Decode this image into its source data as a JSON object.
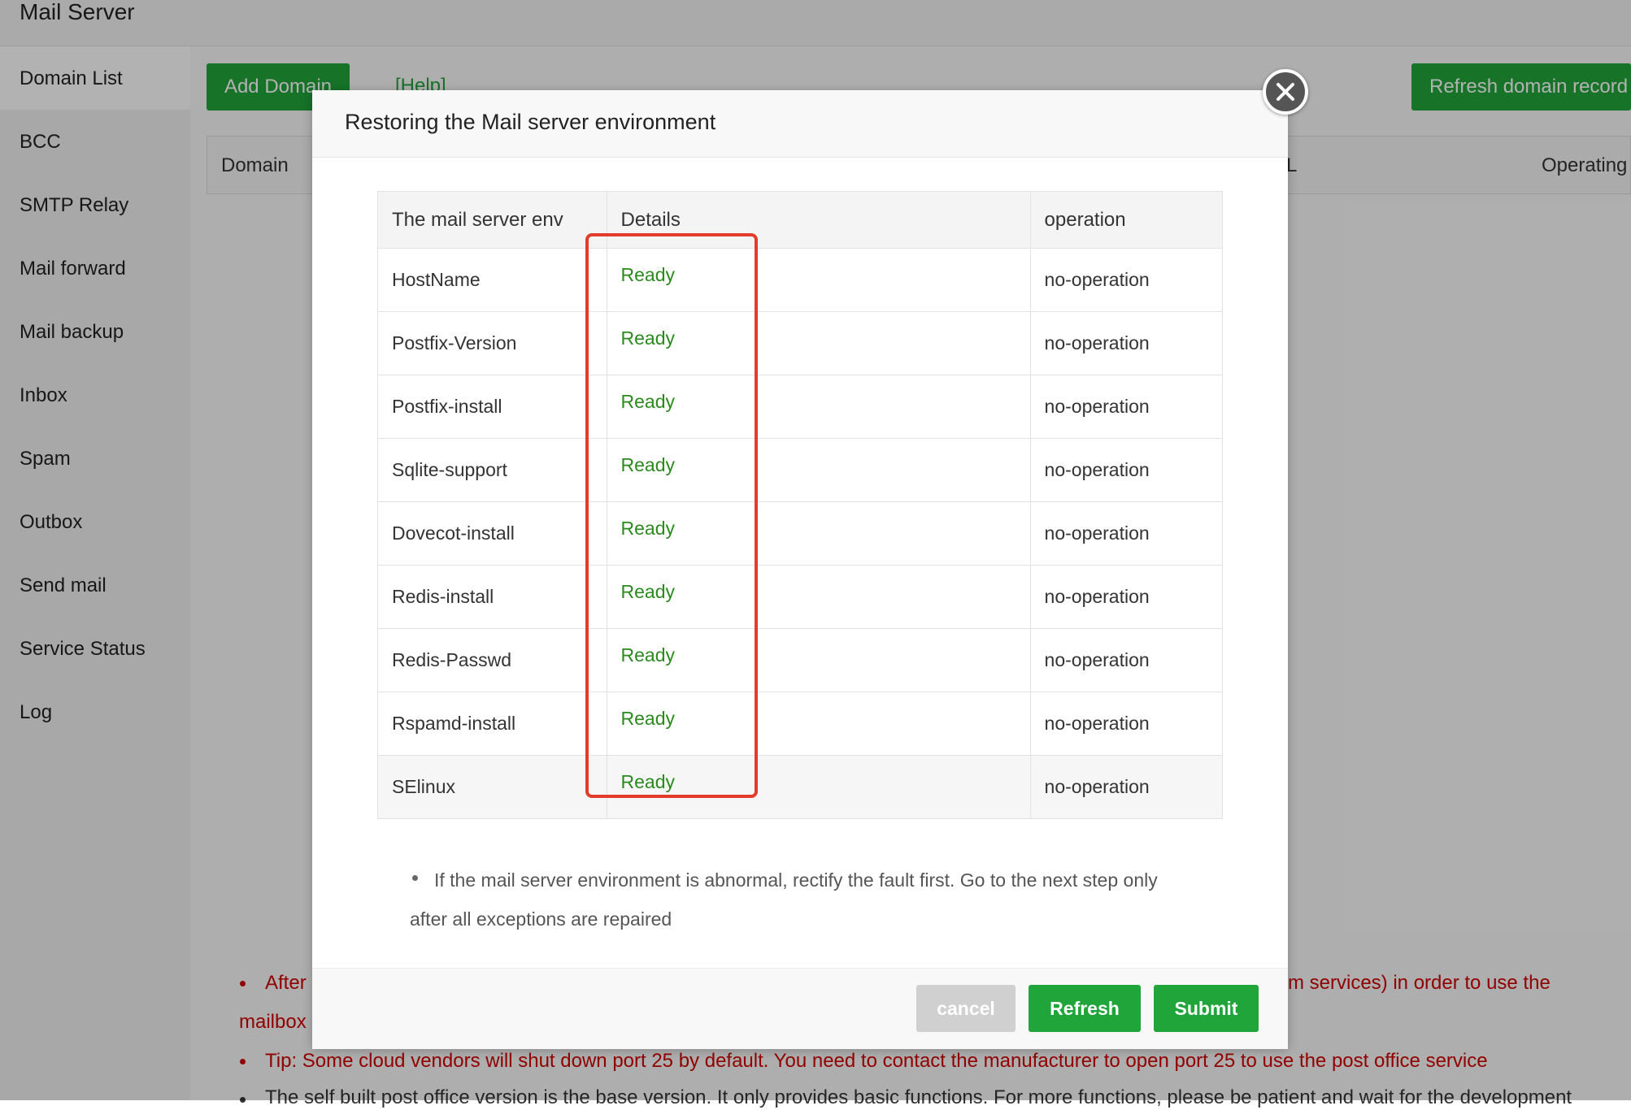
{
  "app": {
    "title": "Mail Server"
  },
  "sidebar": {
    "items": [
      {
        "label": "Domain List"
      },
      {
        "label": "BCC"
      },
      {
        "label": "SMTP Relay"
      },
      {
        "label": "Mail forward"
      },
      {
        "label": "Mail backup"
      },
      {
        "label": "Inbox"
      },
      {
        "label": "Spam"
      },
      {
        "label": "Outbox"
      },
      {
        "label": "Send mail"
      },
      {
        "label": "Service Status"
      },
      {
        "label": "Log"
      }
    ]
  },
  "toolbar": {
    "add_domain": "Add Domain",
    "help": "[Help]",
    "refresh_domain_record": "Refresh domain record"
  },
  "domain_table": {
    "headers": {
      "domain": "Domain",
      "col_l": "L",
      "operating": "Operating"
    }
  },
  "background_tips": {
    "tip1_start": "After",
    "tip1_end": "m services) in order to use the",
    "tip1_cont": "mailbox",
    "tip2": "Tip: Some cloud vendors will shut down port 25 by default. You need to contact the manufacturer to open port 25 to use the post office service",
    "tip3": "The self built post office version is the base version. It only provides basic functions. For more functions, please be patient and wait for the development"
  },
  "modal": {
    "title": "Restoring the Mail server environment",
    "table": {
      "headers": [
        "The mail server env",
        "Details",
        "operation"
      ],
      "rows": [
        {
          "env": "HostName",
          "details": "Ready",
          "operation": "no-operation"
        },
        {
          "env": "Postfix-Version",
          "details": "Ready",
          "operation": "no-operation"
        },
        {
          "env": "Postfix-install",
          "details": "Ready",
          "operation": "no-operation"
        },
        {
          "env": "Sqlite-support",
          "details": "Ready",
          "operation": "no-operation"
        },
        {
          "env": "Dovecot-install",
          "details": "Ready",
          "operation": "no-operation"
        },
        {
          "env": "Redis-install",
          "details": "Ready",
          "operation": "no-operation"
        },
        {
          "env": "Redis-Passwd",
          "details": "Ready",
          "operation": "no-operation"
        },
        {
          "env": "Rspamd-install",
          "details": "Ready",
          "operation": "no-operation"
        },
        {
          "env": "SElinux",
          "details": "Ready",
          "operation": "no-operation"
        }
      ]
    },
    "note": "If the mail server environment is abnormal, rectify the fault first. Go to the next step only after all exceptions are repaired",
    "buttons": {
      "cancel": "cancel",
      "refresh": "Refresh",
      "submit": "Submit"
    }
  },
  "colors": {
    "brand_green": "#20a53a",
    "ready_green": "#2b8a1e",
    "highlight_red": "#e33c2a",
    "tip_red": "#d00000",
    "cancel_gray": "#d0d0d0"
  },
  "icons": {
    "close": "close-icon"
  }
}
